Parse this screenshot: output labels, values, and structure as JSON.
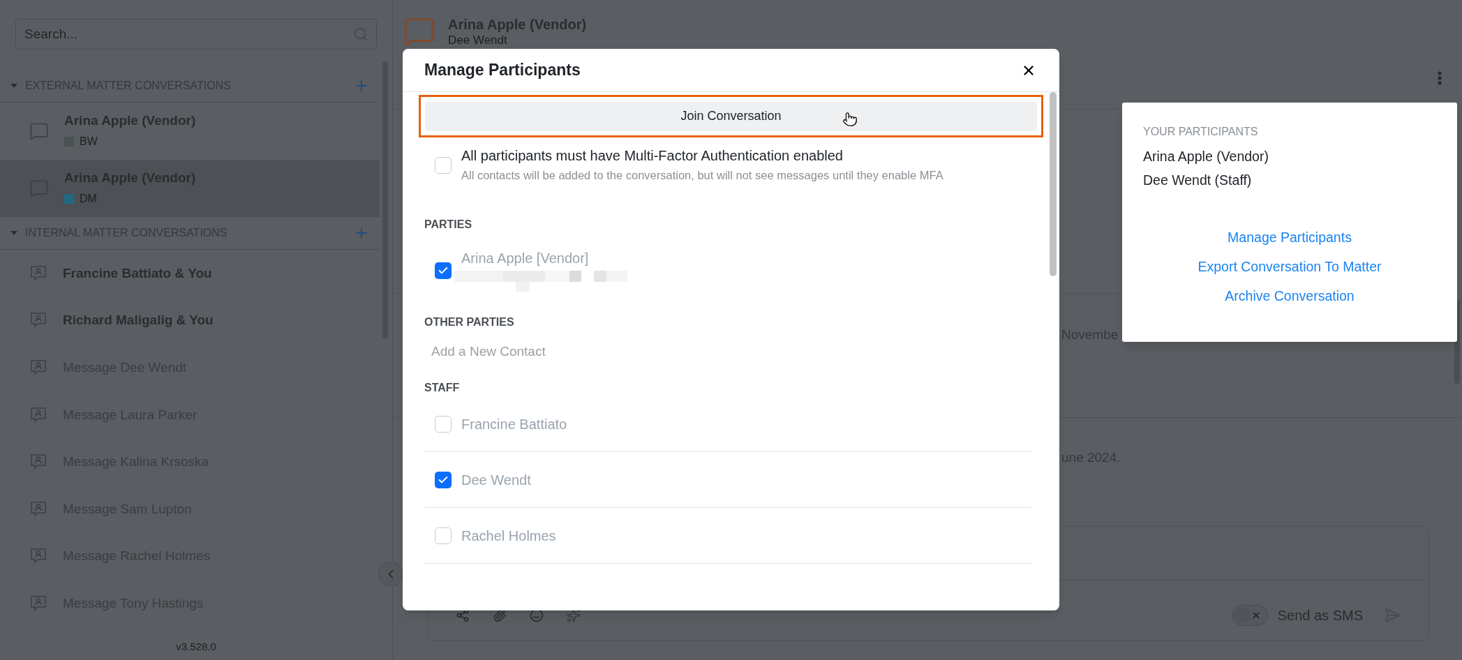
{
  "sidebar": {
    "search": {
      "placeholder": "Search..."
    },
    "sections": [
      {
        "kind": "external",
        "title": "EXTERNAL MATTER CONVERSATIONS",
        "expanded": true,
        "items": [
          {
            "title": "Arina Apple (Vendor)",
            "tag": "BW",
            "color": "#4b5254",
            "selected": false,
            "unread": true
          },
          {
            "title": "Arina Apple (Vendor)",
            "tag": "DM",
            "color": "#1f6b82",
            "selected": true,
            "unread": true
          }
        ]
      },
      {
        "kind": "internal",
        "title": "INTERNAL MATTER CONVERSATIONS",
        "expanded": true,
        "items": [
          {
            "title": "Francine Battiato & You",
            "selected": false,
            "unread": true
          },
          {
            "title": "Richard Maligalig & You",
            "selected": false,
            "unread": true
          },
          {
            "title": "Message Dee Wendt",
            "selected": false,
            "unread": false
          },
          {
            "title": "Message Laura Parker",
            "selected": false,
            "unread": false
          },
          {
            "title": "Message Kalina Krsoska",
            "selected": false,
            "unread": false
          },
          {
            "title": "Message Sam Lupton",
            "selected": false,
            "unread": false
          },
          {
            "title": "Message Rachel Holmes",
            "selected": false,
            "unread": false
          },
          {
            "title": "Message Tony Hastings",
            "selected": false,
            "unread": false
          }
        ]
      }
    ],
    "version": "v3.528.0"
  },
  "conversation": {
    "title": "Arina Apple (Vendor)",
    "subtitle": "Dee Wendt",
    "message_fragments": [
      "Novembe",
      "une 2024."
    ],
    "composer": {
      "sms": {
        "label": "Send as SMS",
        "on": false
      }
    }
  },
  "modal": {
    "title": "Manage Participants",
    "join_button": "Join Conversation",
    "mfa": {
      "label": "All participants must have Multi-Factor Authentication enabled",
      "hint": "All contacts will be added to the conversation, but will not see messages until they enable MFA",
      "checked": false
    },
    "sections": [
      {
        "kind": "people",
        "title": "PARTIES",
        "people": [
          {
            "name": "Arina Apple [Vendor]",
            "checked": true,
            "redacted_detail": true
          }
        ]
      },
      {
        "kind": "add",
        "title": "OTHER PARTIES",
        "placeholder": "Add a New Contact"
      },
      {
        "kind": "people",
        "title": "STAFF",
        "people": [
          {
            "name": "Francine Battiato",
            "checked": false,
            "redacted_detail": false
          },
          {
            "name": "Dee Wendt",
            "checked": true,
            "redacted_detail": false
          },
          {
            "name": "Rachel Holmes",
            "checked": false,
            "redacted_detail": false
          }
        ]
      }
    ]
  },
  "popup": {
    "title": "YOUR PARTICIPANTS",
    "participants": [
      "Arina Apple (Vendor)",
      "Dee Wendt (Staff)"
    ],
    "actions": [
      "Manage Participants",
      "Export Conversation To Matter",
      "Archive Conversation"
    ]
  }
}
